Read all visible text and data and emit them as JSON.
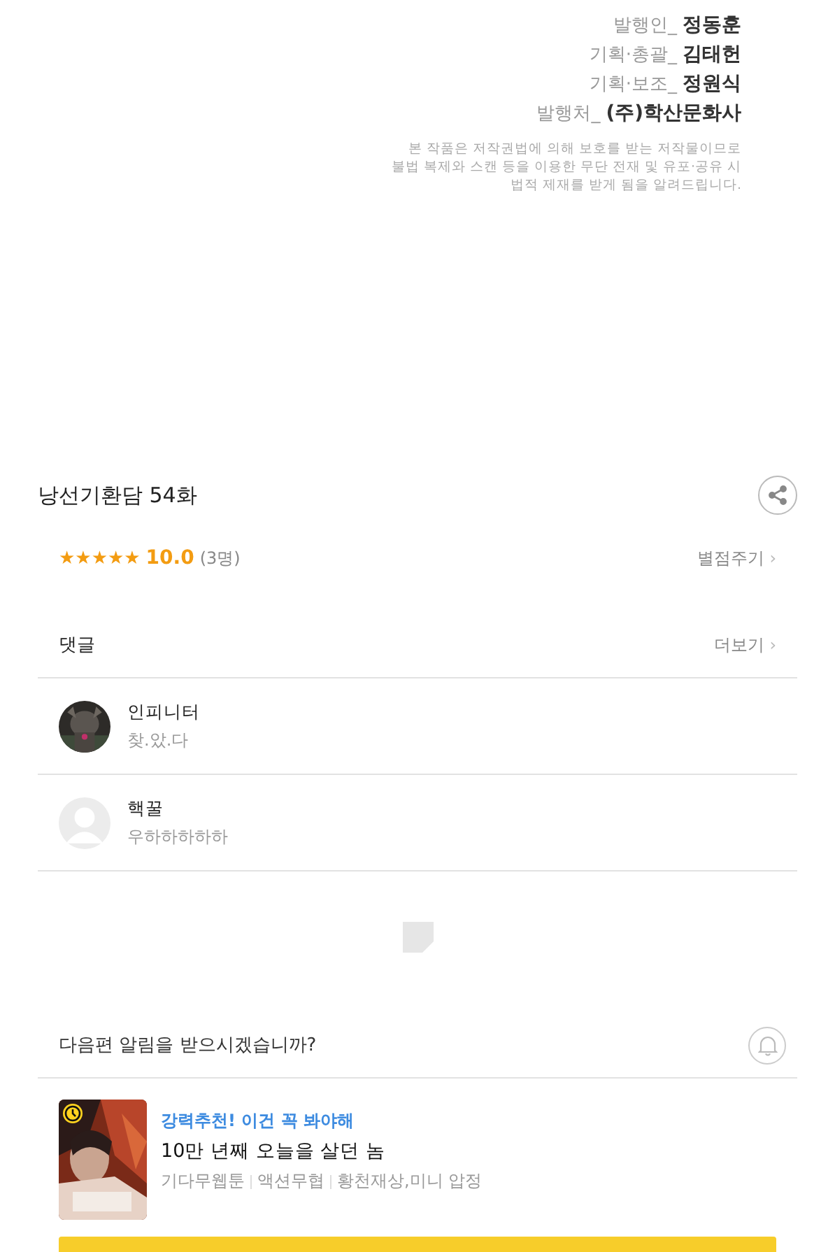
{
  "credits": [
    {
      "role": "발행인_",
      "name": "정동훈"
    },
    {
      "role": "기획·총괄_",
      "name": "김태헌"
    },
    {
      "role": "기획·보조_",
      "name": "정원식"
    },
    {
      "role": "발행처_",
      "name": "(주)학산문화사"
    }
  ],
  "notice": [
    "본 작품은 저작권법에 의해 보호를 받는 저작물이므로",
    "불법 복제와 스캔 등을 이용한 무단 전재 및 유포·공유 시",
    "법적 제재를 받게 됨을 알려드립니다."
  ],
  "episode": {
    "title": "낭선기환담 54화"
  },
  "rating": {
    "stars": 5,
    "score": "10.0",
    "count": "(3명)",
    "action": "별점주기",
    "chevron": "›"
  },
  "comments_section": {
    "label": "댓글",
    "more": "더보기",
    "chevron": "›"
  },
  "comments": [
    {
      "kind": "picture",
      "author": "인피니터",
      "text": "찾.았.다"
    },
    {
      "kind": "default",
      "author": "핵꿀",
      "text": "우하하하하하"
    }
  ],
  "notify": {
    "prompt": "다음편 알림을 받으시겠습니까?"
  },
  "recommend": {
    "tag": "강력추천! 이건 꼭 봐야해",
    "title": "10만 년째 오늘을 살던 놈",
    "meta": [
      "기다무웹툰",
      "액션무협",
      "황천재상,미니 압정"
    ]
  }
}
